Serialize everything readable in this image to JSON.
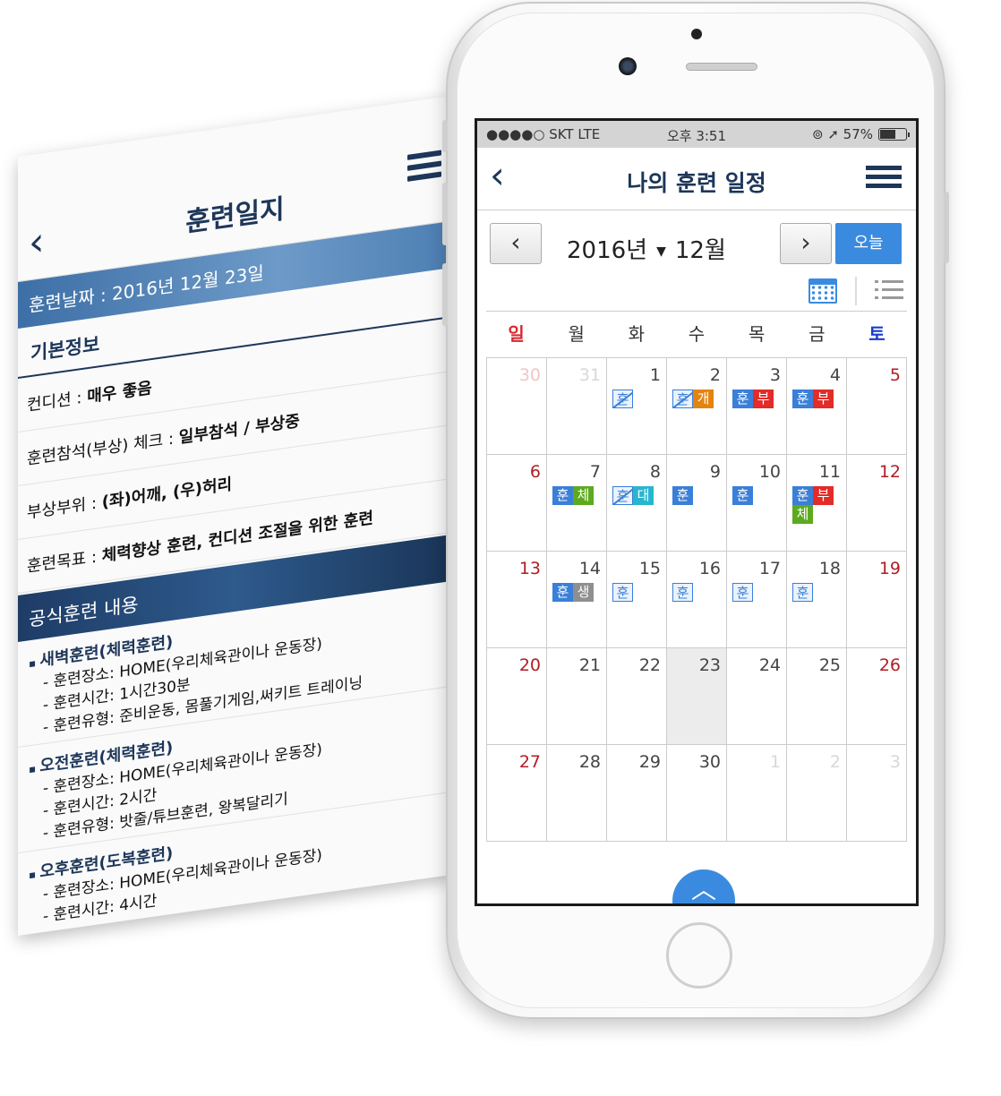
{
  "log": {
    "title": "훈련일지",
    "date": "훈련날짜 : 2016년 12월 23일",
    "basic_section": "기본정보",
    "rows": [
      {
        "label": "컨디션 : ",
        "value": "매우 좋음"
      },
      {
        "label": "훈련참석(부상) 체크 : ",
        "value": "일부참석 / 부상중"
      },
      {
        "label": "부상부위 : ",
        "value": "(좌)어깨, (우)허리"
      },
      {
        "label": "훈련목표 : ",
        "value": "체력향상 훈련, 컨디션 조절을 위한 훈련"
      }
    ],
    "official_section": "공식훈련 내용",
    "blocks": [
      {
        "title": "새벽훈련(체력훈련)",
        "lines": [
          "- 훈련장소: HOME(우리체육관이나 운동장)",
          "- 훈련시간: 1시간30분",
          "- 훈련유형: 준비운동, 몸풀기게임,써키트 트레이닝"
        ]
      },
      {
        "title": "오전훈련(체력훈련)",
        "lines": [
          "- 훈련장소: HOME(우리체육관이나 운동장)",
          "- 훈련시간: 2시간",
          "- 훈련유형: 밧줄/튜브훈련, 왕복달리기"
        ]
      },
      {
        "title": "오후훈련(도복훈련)",
        "lines": [
          "- 훈련장소: HOME(우리체육관이나 운동장)",
          "- 훈련시간: 4시간"
        ]
      }
    ]
  },
  "status": {
    "carrier": "●●●●○ SKT   LTE",
    "time": "오후 3:51",
    "right": "⊚ ➚ 57%",
    "battery_level": 0.57
  },
  "app": {
    "title": "나의 훈련 일정"
  },
  "nav": {
    "prev": "‹",
    "year": "2016년",
    "caret": "▼",
    "month": "12월",
    "next": "›",
    "today": "오늘"
  },
  "weekdays": [
    "일",
    "월",
    "화",
    "수",
    "목",
    "금",
    "토"
  ],
  "weeks": [
    [
      {
        "d": "30",
        "other": true
      },
      {
        "d": "31",
        "other": true
      },
      {
        "d": "1",
        "tags": [
          [
            "s",
            "훈"
          ]
        ]
      },
      {
        "d": "2",
        "tags": [
          [
            "s",
            "훈"
          ],
          [
            "gae",
            "개"
          ]
        ]
      },
      {
        "d": "3",
        "tags": [
          [
            "hun",
            "훈"
          ],
          [
            "bu",
            "부"
          ]
        ]
      },
      {
        "d": "4",
        "tags": [
          [
            "hun",
            "훈"
          ],
          [
            "bu",
            "부"
          ]
        ]
      },
      {
        "d": "5"
      }
    ],
    [
      {
        "d": "6"
      },
      {
        "d": "7",
        "tags": [
          [
            "hun",
            "훈"
          ],
          [
            "che",
            "체"
          ]
        ]
      },
      {
        "d": "8",
        "tags": [
          [
            "s",
            "훈"
          ],
          [
            "dae",
            "대"
          ]
        ]
      },
      {
        "d": "9",
        "tags": [
          [
            "hun",
            "훈"
          ]
        ]
      },
      {
        "d": "10",
        "tags": [
          [
            "hun",
            "훈"
          ]
        ]
      },
      {
        "d": "11",
        "tags": [
          [
            "hun",
            "훈"
          ],
          [
            "bu",
            "부"
          ],
          [
            "che",
            "체"
          ]
        ]
      },
      {
        "d": "12"
      }
    ],
    [
      {
        "d": "13"
      },
      {
        "d": "14",
        "tags": [
          [
            "hun",
            "훈"
          ],
          [
            "saeng",
            "생"
          ]
        ]
      },
      {
        "d": "15",
        "tags": [
          [
            "o",
            "훈"
          ]
        ]
      },
      {
        "d": "16",
        "tags": [
          [
            "o",
            "훈"
          ]
        ]
      },
      {
        "d": "17",
        "tags": [
          [
            "o",
            "훈"
          ]
        ]
      },
      {
        "d": "18",
        "tags": [
          [
            "o",
            "훈"
          ]
        ]
      },
      {
        "d": "19"
      }
    ],
    [
      {
        "d": "20"
      },
      {
        "d": "21"
      },
      {
        "d": "22"
      },
      {
        "d": "23",
        "today": true
      },
      {
        "d": "24"
      },
      {
        "d": "25"
      },
      {
        "d": "26"
      }
    ],
    [
      {
        "d": "27"
      },
      {
        "d": "28"
      },
      {
        "d": "29"
      },
      {
        "d": "30"
      },
      {
        "d": "1",
        "other": true
      },
      {
        "d": "2",
        "other": true
      },
      {
        "d": "3",
        "other": true
      }
    ]
  ],
  "scroll_up": "︿"
}
